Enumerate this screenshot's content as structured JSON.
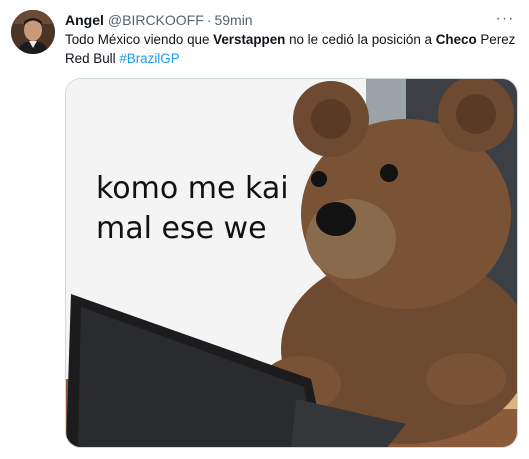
{
  "author": {
    "name": "Angel",
    "handle": "@BIRCKOOFF",
    "separator": "·",
    "time": "59min"
  },
  "menu": {
    "icon": "more-dots-icon",
    "glyph": "···"
  },
  "text": {
    "part1": "Todo México viendo que ",
    "bold1": "Verstappen",
    "part2": " no le cedió la posición a ",
    "bold2": "Checo",
    "part3": " Perez",
    "line2": "Red Bull ",
    "hashtag": "#BrazilGP"
  },
  "media": {
    "meme_line1": "komo me kai",
    "meme_line2": "mal ese we"
  },
  "colors": {
    "link": "#1d9bf0",
    "secondary_text": "#536471",
    "border": "#cfd9de"
  }
}
